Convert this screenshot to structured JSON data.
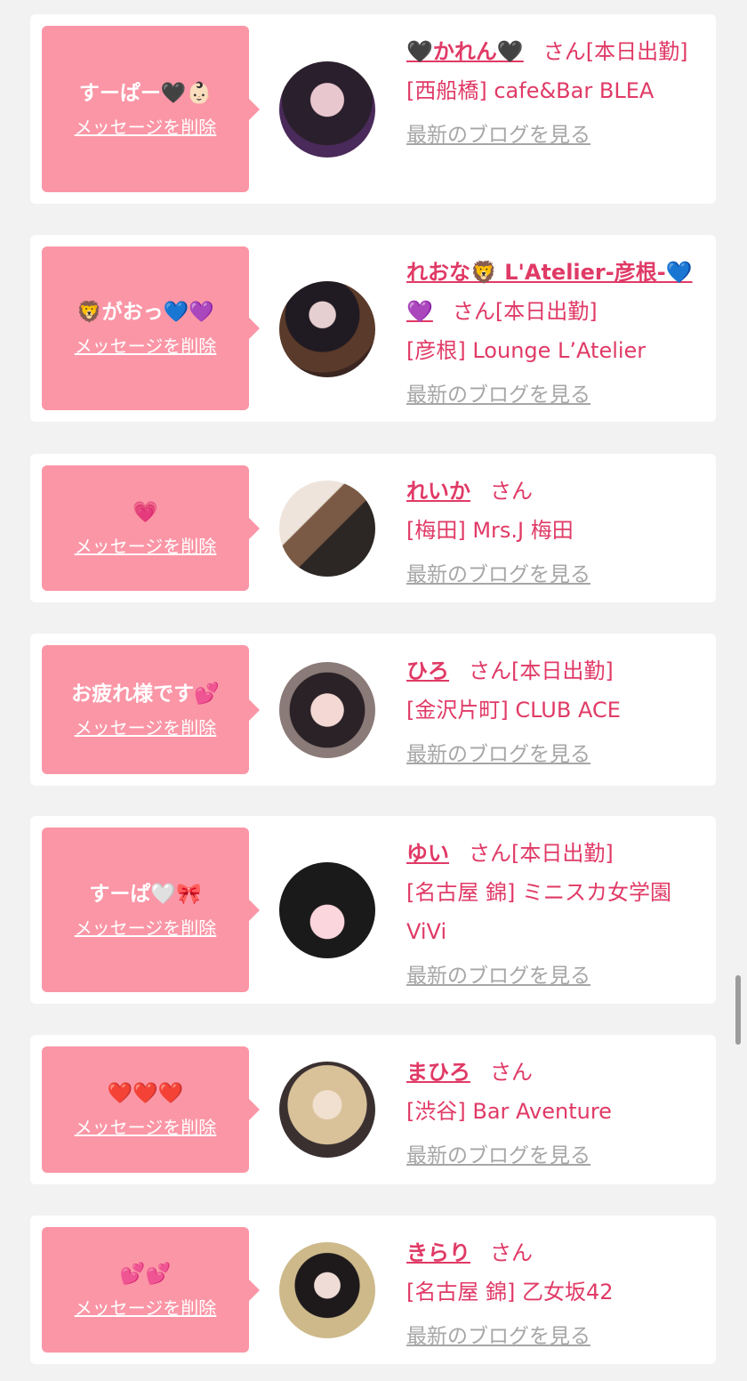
{
  "delete_label": "メッセージを削除",
  "blog_label": "最新のブログを見る",
  "honorific": "さん",
  "colors": {
    "bubble": "#fb96a6",
    "name": "#e03a66",
    "blog_link": "#a6a6a6",
    "card": "#ffffff",
    "background": "#f2f2f2"
  },
  "items": [
    {
      "message": "すーぱー🖤👶🏻",
      "name": "🖤かれん🖤",
      "status": "[本日出勤]",
      "shop": "[西船橋] cafe&Bar BLEA",
      "avatar": "avatar-photo"
    },
    {
      "message": "🦁がおっ💙💜",
      "name": "れおな🦁 L'Atelier-彦根-💙💜",
      "status": "[本日出勤]",
      "shop": "[彦根] Lounge L’Atelier",
      "avatar": "avatar-photo"
    },
    {
      "message": "💗",
      "name": "れいか",
      "status": "",
      "shop": "[梅田] Mrs.J 梅田",
      "avatar": "avatar-photo"
    },
    {
      "message": "お疲れ様です💕",
      "name": "ひろ",
      "status": "[本日出勤]",
      "shop": "[金沢片町] CLUB ACE",
      "avatar": "avatar-photo"
    },
    {
      "message": "すーぱ🤍🎀",
      "name": "ゆい",
      "status": "[本日出勤]",
      "shop": "[名古屋 錦] ミニスカ女学園ViVi",
      "avatar": "avatar-photo"
    },
    {
      "message": "❤️❤️❤️",
      "name": "まひろ",
      "status": "",
      "shop": "[渋谷] Bar Aventure",
      "avatar": "avatar-photo"
    },
    {
      "message": "💕💕",
      "name": "きらり",
      "status": "",
      "shop": "[名古屋 錦] 乙女坂42",
      "avatar": "avatar-photo"
    }
  ]
}
